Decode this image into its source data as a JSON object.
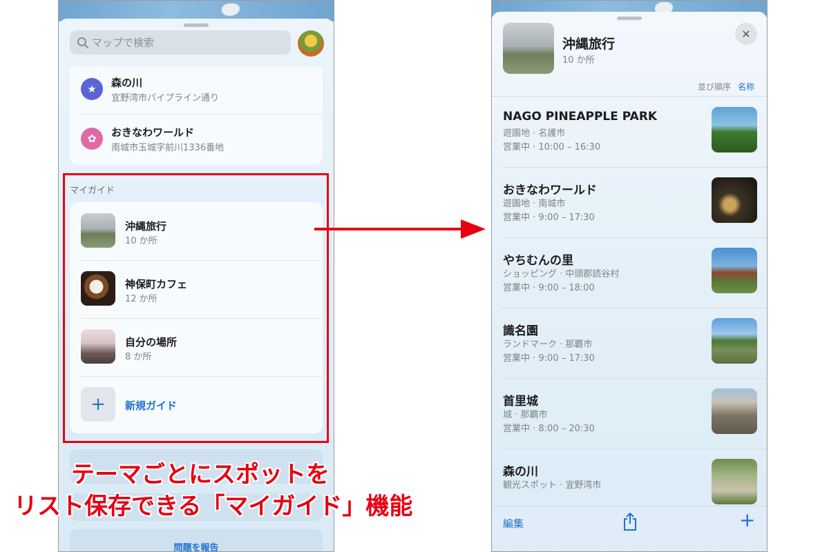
{
  "left": {
    "search_placeholder": "マップで検索",
    "favorites": [
      {
        "title": "森の川",
        "subtitle": "宜野湾市パイプライン通り",
        "icon": "star-icon",
        "color": "#5b63d8"
      },
      {
        "title": "おきなわワールド",
        "subtitle": "南城市玉城字前川1336番地",
        "icon": "ferris-wheel-icon",
        "color": "#e06aa6"
      }
    ],
    "section_label": "マイガイド",
    "guides": [
      {
        "title": "沖縄旅行",
        "count": "10 か所"
      },
      {
        "title": "神保町カフェ",
        "count": "12 か所"
      },
      {
        "title": "自分の場所",
        "count": "8 か所"
      }
    ],
    "new_guide_label": "新規ガイド",
    "report_label": "問題を報告"
  },
  "annotation": {
    "line1": "テーマごとにスポットを",
    "line2": "リスト保存できる「マイガイド」機能",
    "highlight_color": "#e60012"
  },
  "right": {
    "title": "沖縄旅行",
    "count": "10 か所",
    "sort_label": "並び順序",
    "sort_value": "名称",
    "places": [
      {
        "name": "NAGO PINEAPPLE PARK",
        "category": "遊園地 · 名護市",
        "hours": "営業中 · 10:00 – 16:30"
      },
      {
        "name": "おきなわワールド",
        "category": "遊園地 · 南城市",
        "hours": "営業中 · 9:00 – 17:30"
      },
      {
        "name": "やちむんの里",
        "category": "ショッピング · 中頭郡読谷村",
        "hours": "営業中 · 9:00 – 18:00"
      },
      {
        "name": "識名園",
        "category": "ランドマーク · 那覇市",
        "hours": "営業中 · 9:00 – 17:30"
      },
      {
        "name": "首里城",
        "category": "城 · 那覇市",
        "hours": "営業中 · 8:00 – 20:30"
      },
      {
        "name": "森の川",
        "category": "観光スポット · 宜野湾市",
        "hours": ""
      }
    ],
    "toolbar": {
      "edit_label": "編集"
    },
    "accent_color": "#1e72d2"
  }
}
